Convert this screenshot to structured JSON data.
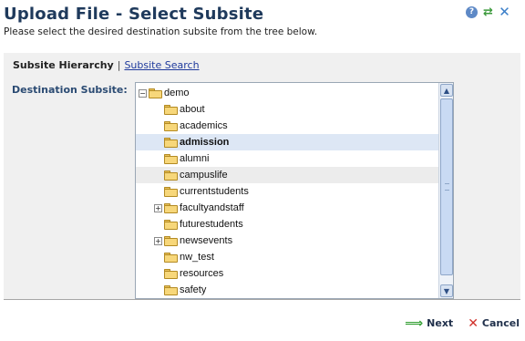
{
  "header": {
    "title": "Upload File - Select Subsite",
    "subtitle": "Please select the desired destination subsite from the tree below.",
    "icons": [
      "help-icon",
      "refresh-icon",
      "close-icon"
    ]
  },
  "tabs": {
    "active": "Subsite Hierarchy",
    "separator": "|",
    "link": "Subsite Search"
  },
  "field": {
    "label": "Destination Subsite:"
  },
  "tree": {
    "items": [
      {
        "label": "demo",
        "expander": "−",
        "selected": false,
        "hover": false
      },
      {
        "label": "about",
        "expander": "",
        "selected": false,
        "hover": false
      },
      {
        "label": "academics",
        "expander": "",
        "selected": false,
        "hover": false
      },
      {
        "label": "admission",
        "expander": "",
        "selected": true,
        "hover": false
      },
      {
        "label": "alumni",
        "expander": "",
        "selected": false,
        "hover": false
      },
      {
        "label": "campuslife",
        "expander": "",
        "selected": false,
        "hover": true
      },
      {
        "label": "currentstudents",
        "expander": "",
        "selected": false,
        "hover": false
      },
      {
        "label": "facultyandstaff",
        "expander": "+",
        "selected": false,
        "hover": false
      },
      {
        "label": "futurestudents",
        "expander": "",
        "selected": false,
        "hover": false
      },
      {
        "label": "newsevents",
        "expander": "+",
        "selected": false,
        "hover": false
      },
      {
        "label": "nw_test",
        "expander": "",
        "selected": false,
        "hover": false
      },
      {
        "label": "resources",
        "expander": "",
        "selected": false,
        "hover": false
      },
      {
        "label": "safety",
        "expander": "",
        "selected": false,
        "hover": false
      },
      {
        "label": "",
        "expander": "",
        "selected": false,
        "hover": false
      }
    ]
  },
  "footer": {
    "next_label": "Next",
    "cancel_label": "Cancel"
  },
  "colors": {
    "title": "#1f3a5c",
    "selected_row": "#dde7f5",
    "hover_row": "#ececec",
    "folder": "#f7d77a",
    "next_arrow": "#3aa33a",
    "cancel_x": "#d0302a"
  }
}
